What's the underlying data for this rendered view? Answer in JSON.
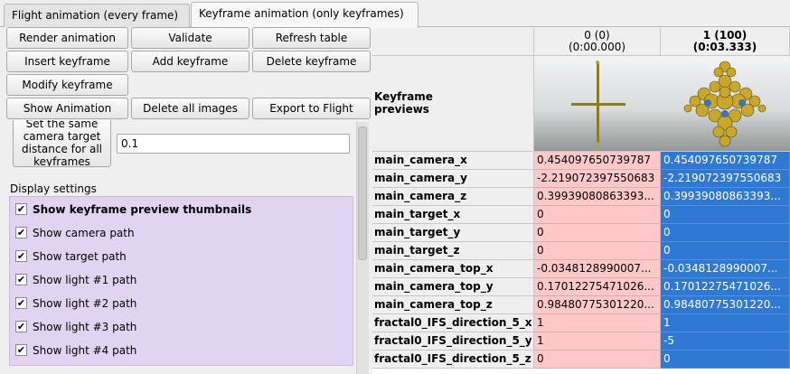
{
  "tabs": [
    "Flight animation (every frame)",
    "Keyframe animation (only keyframes)"
  ],
  "buttons": {
    "render": "Render animation",
    "validate": "Validate",
    "refresh": "Refresh table",
    "insert": "Insert keyframe",
    "add": "Add keyframe",
    "delete": "Delete keyframe",
    "modify": "Modify keyframe",
    "show_anim": "Show Animation",
    "delete_images": "Delete all images",
    "export": "Export to Flight"
  },
  "distance": {
    "label_lines": [
      "Set the same",
      "camera target",
      "distance for all",
      "keyframes"
    ],
    "value": "0.1"
  },
  "display_settings": {
    "title": "Display settings",
    "items": [
      {
        "label": "Show keyframe preview thumbnails",
        "checked": "✔"
      },
      {
        "label": "Show camera path",
        "checked": "✔"
      },
      {
        "label": "Show target path",
        "checked": "✔"
      },
      {
        "label": "Show light #1 path",
        "checked": "✔"
      },
      {
        "label": "Show light #2 path",
        "checked": "✔"
      },
      {
        "label": "Show light #3 path",
        "checked": "✔"
      },
      {
        "label": "Show light #4 path",
        "checked": "✔"
      }
    ]
  },
  "table": {
    "columns": [
      {
        "line1": "0 (0)",
        "line2": "(0:00.000)"
      },
      {
        "line1": "1 (100)",
        "line2": "(0:03.333)"
      }
    ],
    "preview_label_lines": [
      "Keyframe",
      "previews"
    ],
    "rows": [
      {
        "name": "main_camera_x",
        "v0": "0.454097650739787",
        "v1": "0.454097650739787"
      },
      {
        "name": "main_camera_y",
        "v0": "-2.219072397550683",
        "v1": "-2.219072397550683"
      },
      {
        "name": "main_camera_z",
        "v0": "0.39939080863393...",
        "v1": "0.39939080863393..."
      },
      {
        "name": "main_target_x",
        "v0": "0",
        "v1": "0"
      },
      {
        "name": "main_target_y",
        "v0": "0",
        "v1": "0"
      },
      {
        "name": "main_target_z",
        "v0": "0",
        "v1": "0"
      },
      {
        "name": "main_camera_top_x",
        "v0": "-0.0348128990007...",
        "v1": "-0.0348128990007..."
      },
      {
        "name": "main_camera_top_y",
        "v0": "0.17012275471026...",
        "v1": "0.17012275471026..."
      },
      {
        "name": "main_camera_top_z",
        "v0": "0.98480775301220...",
        "v1": "0.98480775301220..."
      },
      {
        "name": "fractal0_IFS_direction_5_x",
        "v0": "1",
        "v1": "1"
      },
      {
        "name": "fractal0_IFS_direction_5_y",
        "v0": "1",
        "v1": "-5"
      },
      {
        "name": "fractal0_IFS_direction_5_z",
        "v0": "0",
        "v1": "0"
      }
    ]
  }
}
